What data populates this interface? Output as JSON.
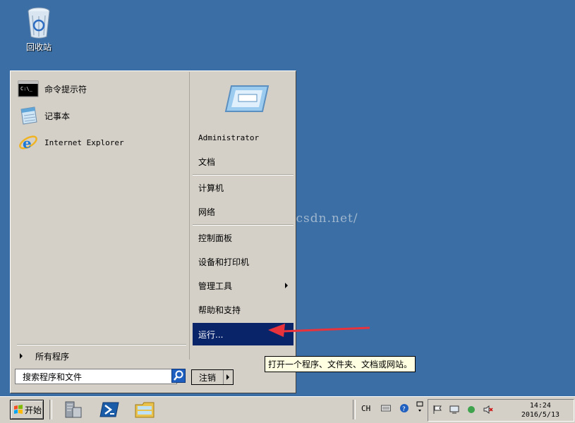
{
  "desktop": {
    "recycle_bin_label": "回收站",
    "watermark": "http://blog.csdn.net/"
  },
  "start_menu": {
    "pinned": [
      {
        "label": "命令提示符",
        "icon": "cmd-icon"
      },
      {
        "label": "记事本",
        "icon": "notepad-icon"
      },
      {
        "label": "Internet Explorer",
        "icon": "ie-icon"
      }
    ],
    "all_programs_label": "所有程序",
    "search_placeholder": "搜索程序和文件",
    "right": {
      "user_name": "Administrator",
      "documents": "文档",
      "computer": "计算机",
      "network": "网络",
      "control_panel": "控制面板",
      "devices_printers": "设备和打印机",
      "admin_tools": "管理工具",
      "help_support": "帮助和支持",
      "run": "运行..."
    },
    "logoff_label": "注销",
    "selected_item": "运行..."
  },
  "tooltip": "打开一个程序、文件夹、文档或网站。",
  "taskbar": {
    "start_label": "开始",
    "pinned_icons": [
      "server-manager-icon",
      "powershell-icon",
      "explorer-icon"
    ],
    "language": "CH",
    "clock_time": "14:24",
    "clock_date": "2016/5/13"
  },
  "colors": {
    "desktop": "#3a6ea5",
    "menu_face": "#d4d0c8",
    "selection": "#0a246a",
    "arrow": "#e8323c",
    "tooltip_bg": "#ffffe1"
  }
}
